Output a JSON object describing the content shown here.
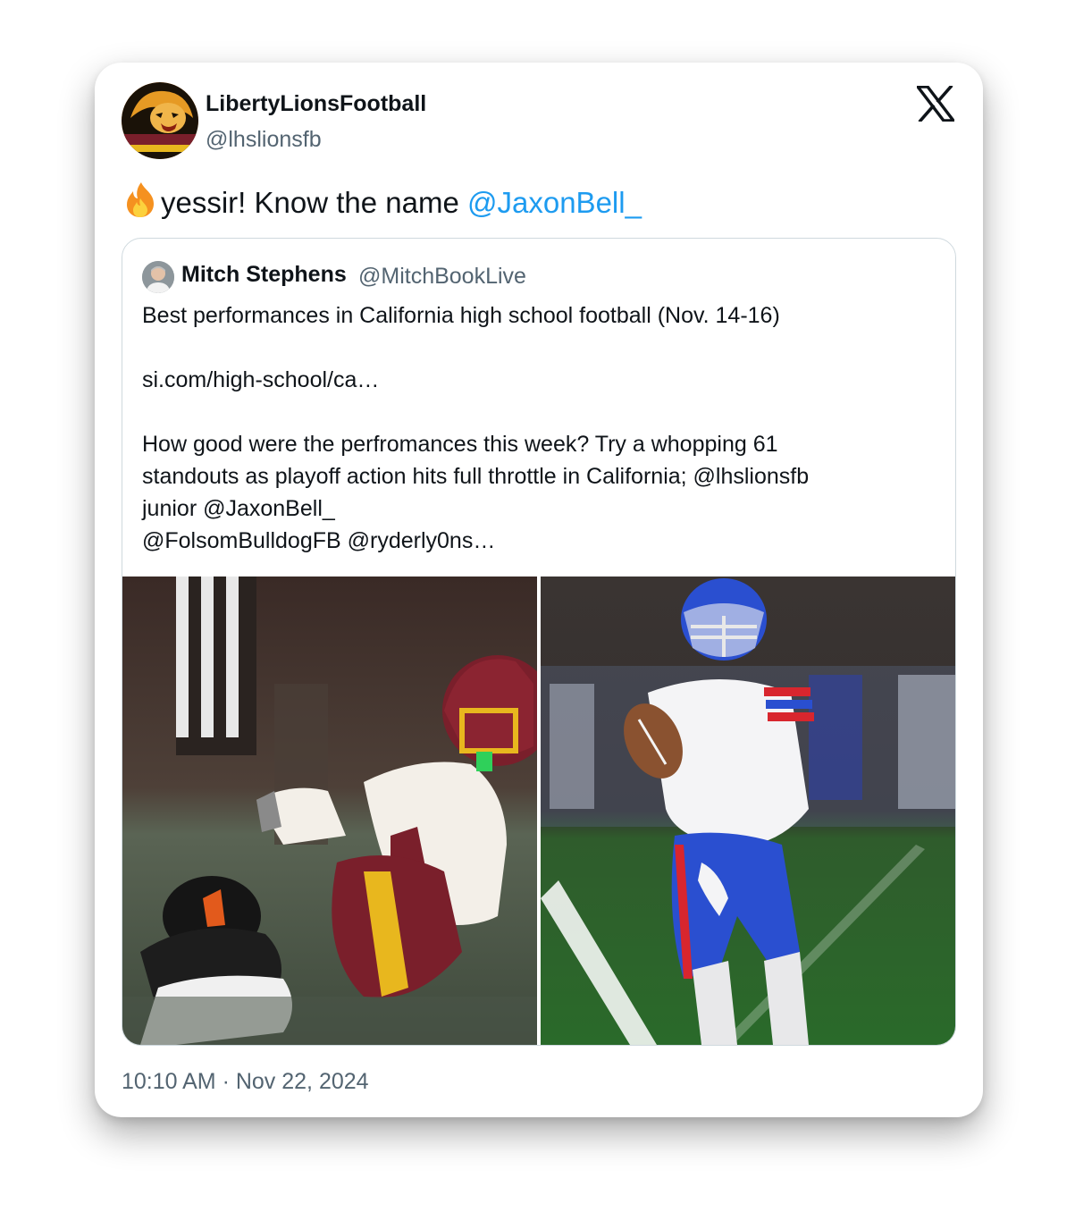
{
  "tweet": {
    "display_name": "LibertyLionsFootball",
    "handle": "@lhslionsfb",
    "avatar_icon": "liberty-lions-logo",
    "text": "yessir! Know the name ",
    "mention": "@JaxonBell_",
    "timestamp": "10:10 AM · Nov 22, 2024"
  },
  "quote": {
    "display_name": "Mitch Stephens",
    "handle": "@MitchBookLive",
    "lines": [
      "Best performances in California high school football (Nov. 14-16)",
      "si.com/high-school/ca…",
      "How good were the perfromances this week? Try a whopping 61",
      "standouts as playoff action hits full throttle in California; @lhslionsfb",
      "junior @JaxonBell_",
      "@FolsomBulldogFB @ryderly0ns…"
    ]
  },
  "colors": {
    "accent": "#1d9bf0",
    "secondary_text": "#536471",
    "liberty_maroon": "#7a1f2b",
    "liberty_gold": "#e8b71e",
    "folsom_blue": "#2a4fd0",
    "folsom_red": "#d8262e"
  }
}
